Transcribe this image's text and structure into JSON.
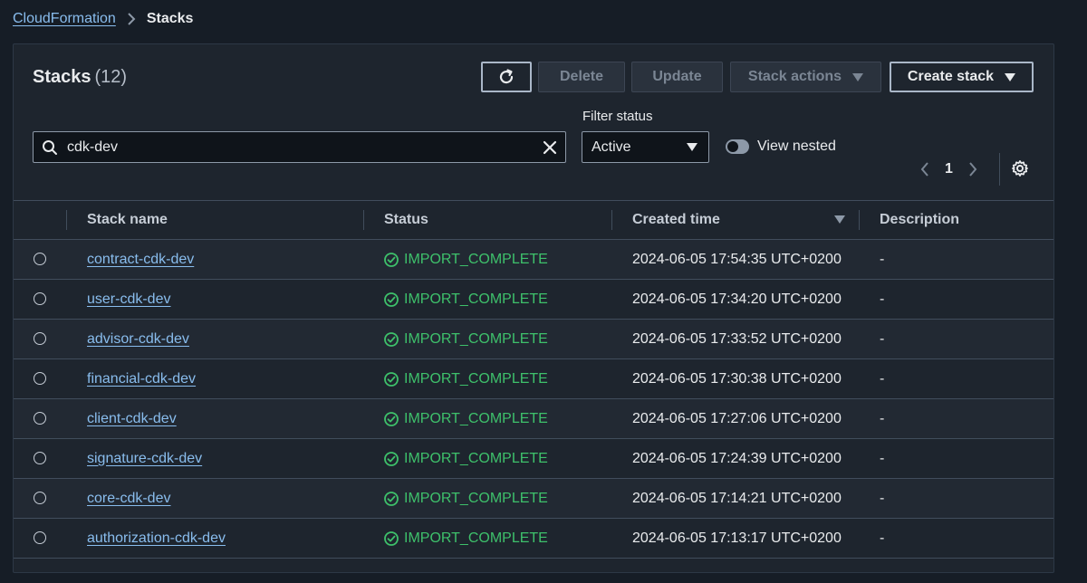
{
  "breadcrumb": {
    "parent": "CloudFormation",
    "current": "Stacks"
  },
  "panel": {
    "title": "Stacks",
    "count": "(12)"
  },
  "buttons": {
    "refresh_icon": "refresh-icon",
    "delete": "Delete",
    "update": "Update",
    "stack_actions": "Stack actions",
    "create_stack": "Create stack"
  },
  "search": {
    "value": "cdk-dev",
    "icon": "search-icon",
    "clear_icon": "close-icon"
  },
  "filter": {
    "label": "Filter status",
    "selected": "Active"
  },
  "toggle": {
    "label": "View nested",
    "on": false
  },
  "pagination": {
    "page": "1"
  },
  "columns": {
    "stack_name": "Stack name",
    "status": "Status",
    "created_time": "Created time",
    "description": "Description"
  },
  "rows": [
    {
      "name": "contract-cdk-dev",
      "status": "IMPORT_COMPLETE",
      "created": "2024-06-05 17:54:35 UTC+0200",
      "description": "-"
    },
    {
      "name": "user-cdk-dev",
      "status": "IMPORT_COMPLETE",
      "created": "2024-06-05 17:34:20 UTC+0200",
      "description": "-"
    },
    {
      "name": "advisor-cdk-dev",
      "status": "IMPORT_COMPLETE",
      "created": "2024-06-05 17:33:52 UTC+0200",
      "description": "-"
    },
    {
      "name": "financial-cdk-dev",
      "status": "IMPORT_COMPLETE",
      "created": "2024-06-05 17:30:38 UTC+0200",
      "description": "-"
    },
    {
      "name": "client-cdk-dev",
      "status": "IMPORT_COMPLETE",
      "created": "2024-06-05 17:27:06 UTC+0200",
      "description": "-"
    },
    {
      "name": "signature-cdk-dev",
      "status": "IMPORT_COMPLETE",
      "created": "2024-06-05 17:24:39 UTC+0200",
      "description": "-"
    },
    {
      "name": "core-cdk-dev",
      "status": "IMPORT_COMPLETE",
      "created": "2024-06-05 17:14:21 UTC+0200",
      "description": "-"
    },
    {
      "name": "authorization-cdk-dev",
      "status": "IMPORT_COMPLETE",
      "created": "2024-06-05 17:13:17 UTC+0200",
      "description": "-"
    }
  ],
  "colors": {
    "link": "#89bdee",
    "success": "#3ec16b",
    "panel_bg": "#1e252e",
    "page_bg": "#161d26"
  }
}
